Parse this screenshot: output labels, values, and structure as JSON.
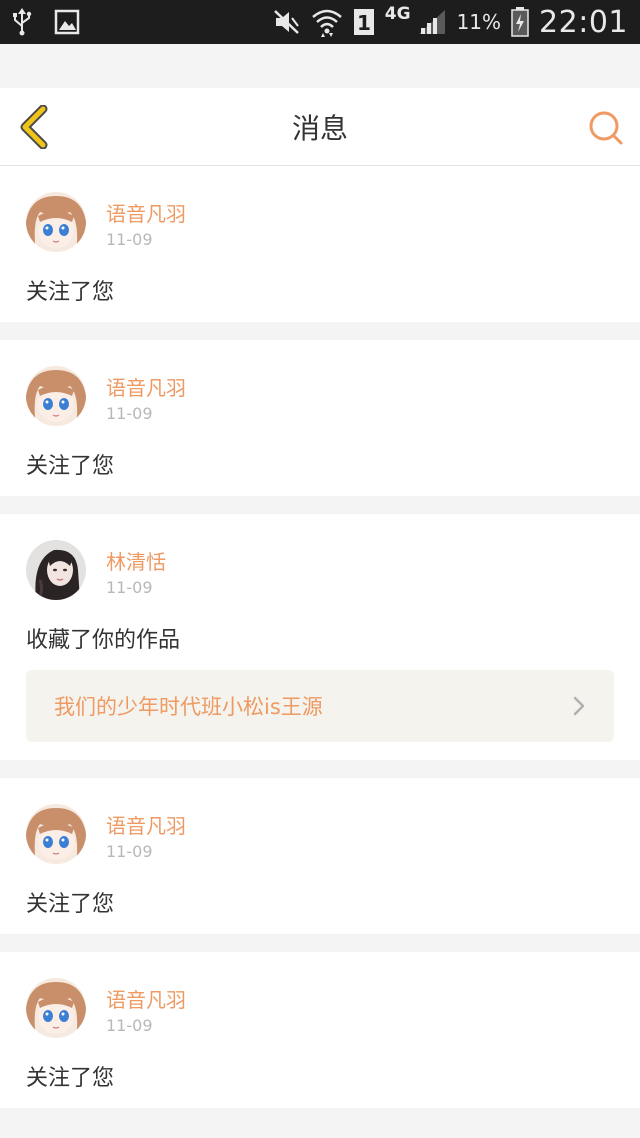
{
  "status_bar": {
    "network": "4G",
    "battery_percent": "11%",
    "time": "22:01",
    "sim_slot": "1",
    "icons": [
      "usb-icon",
      "image-icon",
      "mute-icon",
      "wifi-icon",
      "sim-icon",
      "signal-icon",
      "battery-icon"
    ]
  },
  "header": {
    "title": "消息",
    "back_icon": "chevron-left-icon",
    "search_icon": "search-icon"
  },
  "notifications": [
    {
      "user": "语音凡羽",
      "date": "11-09",
      "action": "关注了您",
      "avatar": "anime-girl"
    },
    {
      "user": "语音凡羽",
      "date": "11-09",
      "action": "关注了您",
      "avatar": "anime-girl"
    },
    {
      "user": "林清恬",
      "date": "11-09",
      "action": "收藏了你的作品",
      "avatar": "photo-girl",
      "work_title": "我们的少年时代班小松is王源"
    },
    {
      "user": "语音凡羽",
      "date": "11-09",
      "action": "关注了您",
      "avatar": "anime-girl"
    },
    {
      "user": "语音凡羽",
      "date": "11-09",
      "action": "关注了您",
      "avatar": "anime-girl"
    }
  ],
  "colors": {
    "accent": "#ee9a62",
    "back_icon": "#f0c419",
    "background": "#f4f4f4"
  }
}
